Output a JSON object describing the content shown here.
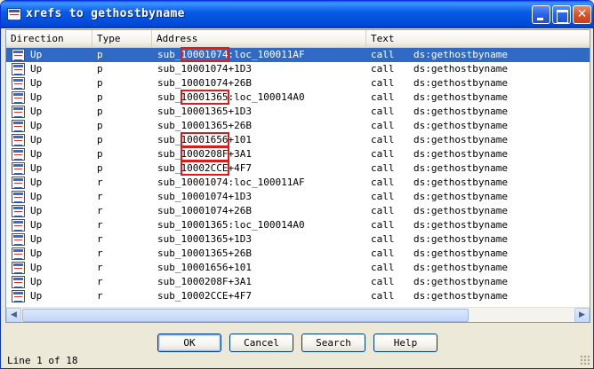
{
  "window": {
    "title": "xrefs to gethostbyname"
  },
  "columns": [
    "Direction",
    "Type",
    "Address",
    "Text"
  ],
  "rows": [
    {
      "direction": "Up",
      "type": "p",
      "addr_pre": "sub_",
      "addr_hl": "10001074",
      "addr_post": ":loc_100011AF",
      "op": "call",
      "operand": "ds:gethostbyname",
      "selected": true
    },
    {
      "direction": "Up",
      "type": "p",
      "addr_pre": "sub_10001074+1D3",
      "addr_hl": "",
      "addr_post": "",
      "op": "call",
      "operand": "ds:gethostbyname"
    },
    {
      "direction": "Up",
      "type": "p",
      "addr_pre": "sub_10001074+26B",
      "addr_hl": "",
      "addr_post": "",
      "op": "call",
      "operand": "ds:gethostbyname"
    },
    {
      "direction": "Up",
      "type": "p",
      "addr_pre": "sub_",
      "addr_hl": "10001365",
      "addr_post": ":loc_100014A0",
      "op": "call",
      "operand": "ds:gethostbyname"
    },
    {
      "direction": "Up",
      "type": "p",
      "addr_pre": "sub_10001365+1D3",
      "addr_hl": "",
      "addr_post": "",
      "op": "call",
      "operand": "ds:gethostbyname"
    },
    {
      "direction": "Up",
      "type": "p",
      "addr_pre": "sub_10001365+26B",
      "addr_hl": "",
      "addr_post": "",
      "op": "call",
      "operand": "ds:gethostbyname"
    },
    {
      "direction": "Up",
      "type": "p",
      "addr_pre": "sub_",
      "addr_hl": "10001656",
      "addr_post": "+101",
      "op": "call",
      "operand": "ds:gethostbyname"
    },
    {
      "direction": "Up",
      "type": "p",
      "addr_pre": "sub_",
      "addr_hl": "1000208F",
      "addr_post": "+3A1",
      "op": "call",
      "operand": "ds:gethostbyname"
    },
    {
      "direction": "Up",
      "type": "p",
      "addr_pre": "sub_",
      "addr_hl": "10002CCE",
      "addr_post": "+4F7",
      "op": "call",
      "operand": "ds:gethostbyname"
    },
    {
      "direction": "Up",
      "type": "r",
      "addr_pre": "sub_10001074:loc_100011AF",
      "addr_hl": "",
      "addr_post": "",
      "op": "call",
      "operand": "ds:gethostbyname"
    },
    {
      "direction": "Up",
      "type": "r",
      "addr_pre": "sub_10001074+1D3",
      "addr_hl": "",
      "addr_post": "",
      "op": "call",
      "operand": "ds:gethostbyname"
    },
    {
      "direction": "Up",
      "type": "r",
      "addr_pre": "sub_10001074+26B",
      "addr_hl": "",
      "addr_post": "",
      "op": "call",
      "operand": "ds:gethostbyname"
    },
    {
      "direction": "Up",
      "type": "r",
      "addr_pre": "sub_10001365:loc_100014A0",
      "addr_hl": "",
      "addr_post": "",
      "op": "call",
      "operand": "ds:gethostbyname"
    },
    {
      "direction": "Up",
      "type": "r",
      "addr_pre": "sub_10001365+1D3",
      "addr_hl": "",
      "addr_post": "",
      "op": "call",
      "operand": "ds:gethostbyname"
    },
    {
      "direction": "Up",
      "type": "r",
      "addr_pre": "sub_10001365+26B",
      "addr_hl": "",
      "addr_post": "",
      "op": "call",
      "operand": "ds:gethostbyname"
    },
    {
      "direction": "Up",
      "type": "r",
      "addr_pre": "sub_10001656+101",
      "addr_hl": "",
      "addr_post": "",
      "op": "call",
      "operand": "ds:gethostbyname"
    },
    {
      "direction": "Up",
      "type": "r",
      "addr_pre": "sub_1000208F+3A1",
      "addr_hl": "",
      "addr_post": "",
      "op": "call",
      "operand": "ds:gethostbyname"
    },
    {
      "direction": "Up",
      "type": "r",
      "addr_pre": "sub_10002CCE+4F7",
      "addr_hl": "",
      "addr_post": "",
      "op": "call",
      "operand": "ds:gethostbyname"
    }
  ],
  "buttons": {
    "ok": "OK",
    "cancel": "Cancel",
    "search": "Search",
    "help": "Help"
  },
  "status": "Line 1 of 18",
  "colors": {
    "selection": "#316ac5",
    "highlight_box": "#e01a1a",
    "titlebar": "#0a5ce6"
  }
}
